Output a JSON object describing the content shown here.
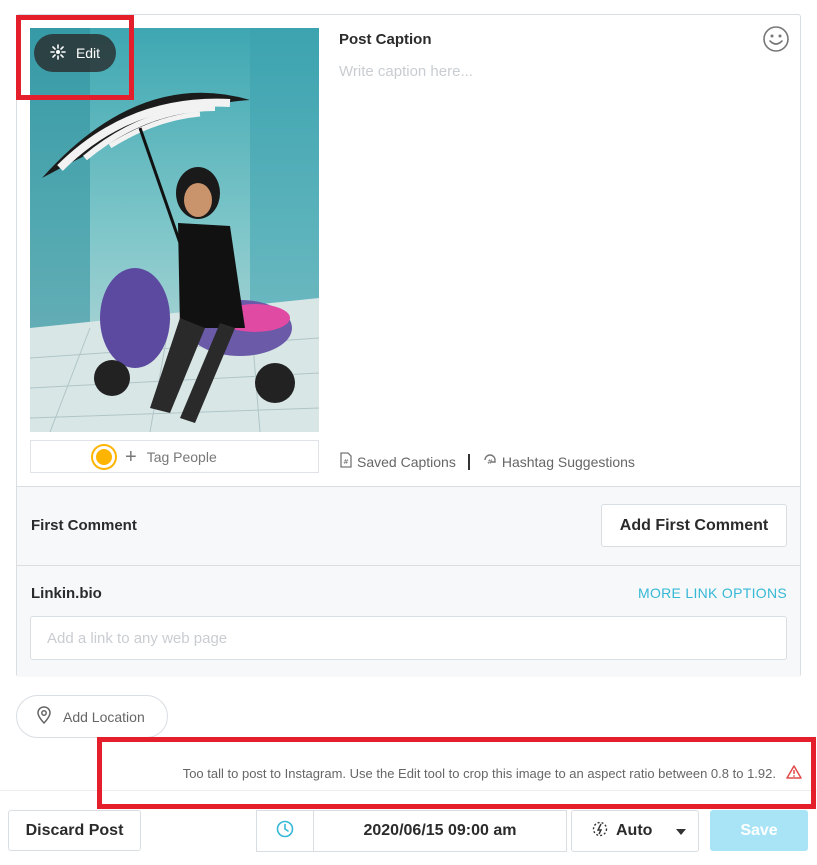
{
  "media": {
    "edit_label": "Edit",
    "tag_people_label": "Tag People"
  },
  "caption": {
    "title": "Post Caption",
    "placeholder": "Write caption here...",
    "saved_captions_label": "Saved Captions",
    "hashtag_suggestions_label": "Hashtag Suggestions"
  },
  "first_comment": {
    "title": "First Comment",
    "button_label": "Add First Comment"
  },
  "linkin_bio": {
    "title": "Linkin.bio",
    "more_options_label": "MORE LINK OPTIONS",
    "placeholder": "Add a link to any web page"
  },
  "location": {
    "label": "Add Location"
  },
  "warning": {
    "message": "Too tall to post to Instagram. Use the Edit tool to crop this image to an aspect ratio between 0.8 to 1.92."
  },
  "footer": {
    "discard_label": "Discard Post",
    "datetime": "2020/06/15 09:00 am",
    "auto_label": "Auto",
    "save_label": "Save"
  },
  "colors": {
    "accent": "#36b8d6",
    "save_disabled": "#a8e3f6",
    "warning_icon": "#e14a4a",
    "highlight": "#e41e2b"
  }
}
